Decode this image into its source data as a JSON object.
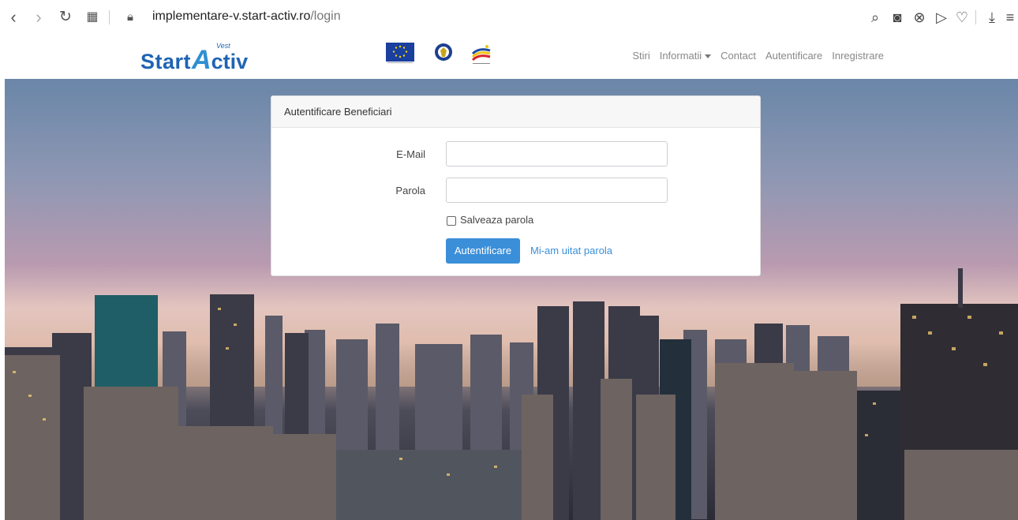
{
  "browser": {
    "url_host": "implementare-v.start-activ.ro",
    "url_path": "/login"
  },
  "site": {
    "logo": {
      "part1": "Start",
      "part2": "A",
      "part3": "ctiv",
      "superscript": "Vest"
    },
    "nav": [
      {
        "label": "Stiri"
      },
      {
        "label": "Informatii",
        "has_dropdown": true
      },
      {
        "label": "Contact"
      },
      {
        "label": "Autentificare"
      },
      {
        "label": "Inregistrare"
      }
    ]
  },
  "login": {
    "title": "Autentificare Beneficiari",
    "email_label": "E-Mail",
    "email_value": "",
    "password_label": "Parola",
    "password_value": "",
    "remember_label": "Salveaza parola",
    "remember_checked": false,
    "submit_label": "Autentificare",
    "forgot_label": "Mi-am uitat parola"
  },
  "colors": {
    "brand": "#1f64b4",
    "primary": "#3b8fd9"
  }
}
